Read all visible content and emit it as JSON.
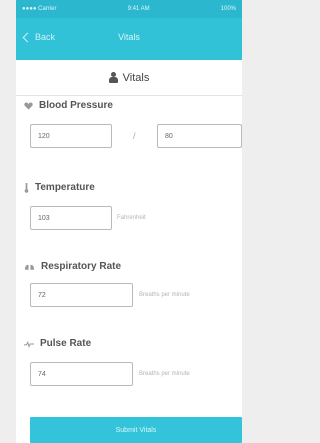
{
  "statusbar": {
    "left": "●●●● Carrier",
    "center": "9:41 AM",
    "right": "100%"
  },
  "navbar": {
    "back_label": "Back",
    "title": "Vitals"
  },
  "section": {
    "title": "Vitals"
  },
  "blood_pressure": {
    "label": "Blood Pressure",
    "systolic": "120",
    "separator": "/",
    "diastolic": "80"
  },
  "temperature": {
    "label": "Temperature",
    "value": "103",
    "unit": "Fahrenheit"
  },
  "respiratory_rate": {
    "label": "Respiratory Rate",
    "value": "72",
    "unit": "Breaths per minute"
  },
  "pulse_rate": {
    "label": "Pulse Rate",
    "value": "74",
    "unit": "Breaths per minute"
  },
  "submit": {
    "label": "Submit Vitals"
  },
  "colors": {
    "accent": "#31c2d8",
    "border": "#b9b9b9",
    "text": "#555555"
  },
  "icons": [
    "back-chevron-icon",
    "person-icon",
    "heart-icon",
    "thermometer-icon",
    "lungs-icon",
    "pulse-icon"
  ]
}
